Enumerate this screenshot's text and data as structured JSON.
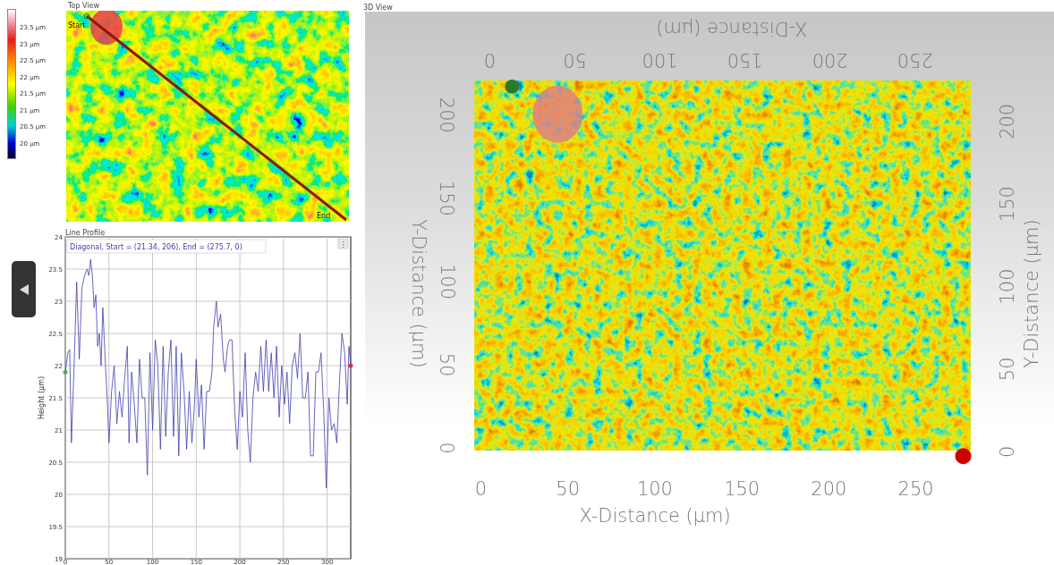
{
  "color_scale": {
    "labels": [
      "23.5 µm",
      "23 µm",
      "22.5 µm",
      "22 µm",
      "21.5 µm",
      "21 µm",
      "20.5 µm",
      "20 µm"
    ]
  },
  "top_view": {
    "title": "Top View",
    "start_label": "Start",
    "end_label": "End"
  },
  "line_profile": {
    "menu_glyph": "⋮",
    "chart_data": {
      "type": "line",
      "grid": true,
      "title": "Line Profile",
      "ylabel": "Height (µm)",
      "xlim": [
        0,
        327
      ],
      "ylim": [
        19,
        24
      ],
      "xticks": [
        0,
        50,
        100,
        150,
        200,
        250,
        300
      ],
      "yticks": [
        19,
        19.5,
        20,
        20.5,
        21,
        21.5,
        22,
        22.5,
        23,
        23.5,
        24
      ],
      "x": [
        0,
        3,
        5,
        7,
        10,
        13,
        16,
        19,
        22,
        25,
        27,
        29,
        31,
        33,
        35,
        37,
        39,
        41,
        43,
        46,
        48,
        50,
        53,
        56,
        59,
        62,
        65,
        68,
        71,
        73,
        76,
        79,
        82,
        85,
        88,
        91,
        94,
        97,
        100,
        103,
        106,
        109,
        112,
        115,
        118,
        121,
        124,
        127,
        130,
        133,
        136,
        139,
        142,
        145,
        148,
        150,
        153,
        156,
        159,
        162,
        165,
        168,
        170,
        173,
        175,
        178,
        181,
        183,
        186,
        188,
        191,
        194,
        197,
        200,
        203,
        206,
        209,
        212,
        215,
        218,
        221,
        224,
        227,
        230,
        233,
        236,
        239,
        242,
        245,
        248,
        251,
        254,
        257,
        260,
        263,
        266,
        269,
        272,
        275,
        278,
        281,
        284,
        287,
        290,
        293,
        296,
        299,
        302,
        305,
        308,
        311,
        314,
        317,
        320,
        323,
        325,
        327
      ],
      "series": [
        {
          "name": "Diagonal, Start = (21.34, 206), End = (275.7, 0)",
          "color": "#3f3fb0",
          "values": [
            21.9,
            22.2,
            22.25,
            20.8,
            22,
            23.3,
            22.1,
            23.2,
            23.4,
            23.5,
            23.4,
            23.65,
            23.4,
            22.9,
            23.1,
            22.3,
            22.5,
            22,
            22.9,
            22,
            21.5,
            20.8,
            21.6,
            22,
            21.1,
            21.6,
            21.2,
            21.8,
            22.3,
            20.8,
            21.9,
            21.4,
            20.8,
            22.1,
            21.5,
            21.5,
            20.3,
            22.2,
            21,
            22.4,
            22,
            20.7,
            22.3,
            20.9,
            21.9,
            22.4,
            20.9,
            22.3,
            20.6,
            22.2,
            21.6,
            20.7,
            21.6,
            20.8,
            21.4,
            22.1,
            21.2,
            21.7,
            20.7,
            21.6,
            21.6,
            21.9,
            22.6,
            23,
            22.6,
            22.8,
            22.1,
            21.9,
            22.3,
            22.4,
            22.4,
            21.3,
            20.7,
            21.6,
            21.2,
            22.2,
            21,
            20.5,
            21.5,
            21.9,
            21.6,
            22.3,
            21.6,
            22.4,
            21.6,
            22.2,
            21.5,
            22.3,
            21.2,
            22,
            21.4,
            21.9,
            21.1,
            22,
            22.2,
            21.8,
            22.5,
            21.5,
            21.5,
            21.9,
            20.6,
            20.6,
            21.9,
            21.9,
            22.2,
            21.3,
            20.1,
            21.5,
            21,
            21.1,
            20.8,
            21.7,
            22.5,
            22.2,
            21.4,
            22.3,
            22
          ]
        }
      ]
    }
  },
  "view_3d": {
    "title": "3D View",
    "top_axis": {
      "title": "X-Distance (µm)",
      "ticks": [
        "0",
        "50",
        "100",
        "150",
        "200",
        "250"
      ]
    },
    "left_axis": {
      "title": "Y-Distance (µm)",
      "ticks": [
        "200",
        "150",
        "100",
        "50",
        "0"
      ]
    },
    "right_axis": {
      "title": "Y-Distance (µm)",
      "ticks": [
        "200",
        "150",
        "100",
        "50",
        "0"
      ]
    },
    "bottom_axis": {
      "title": "X-Distance (µm)",
      "ticks": [
        "0",
        "50",
        "100",
        "150",
        "200",
        "250"
      ]
    }
  }
}
